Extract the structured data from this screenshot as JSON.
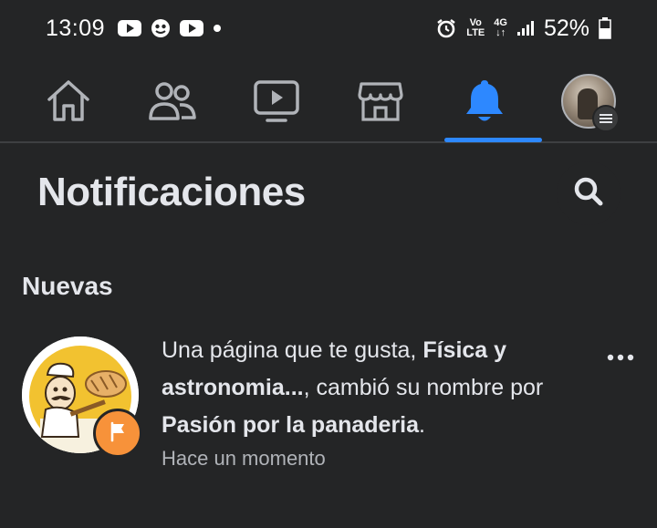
{
  "status_bar": {
    "time": "13:09",
    "volte_top": "Vo",
    "volte_bottom": "LTE",
    "network": "4G",
    "battery": "52%"
  },
  "nav": {
    "items": [
      {
        "icon": "home-icon"
      },
      {
        "icon": "friends-icon"
      },
      {
        "icon": "watch-icon"
      },
      {
        "icon": "marketplace-icon"
      },
      {
        "icon": "bell-icon",
        "active": true
      },
      {
        "icon": "profile-avatar"
      }
    ],
    "active_color": "#2d88ff"
  },
  "page": {
    "title": "Notificaciones",
    "section": "Nuevas"
  },
  "notification": {
    "text_1": "Una página que te gusta, ",
    "bold_1": "Física y astronomia...",
    "text_2": ", cambió su nombre por ",
    "bold_2": "Pasión por la panaderia",
    "text_3": ".",
    "time": "Hace un momento",
    "badge_color": "#f7923a"
  }
}
